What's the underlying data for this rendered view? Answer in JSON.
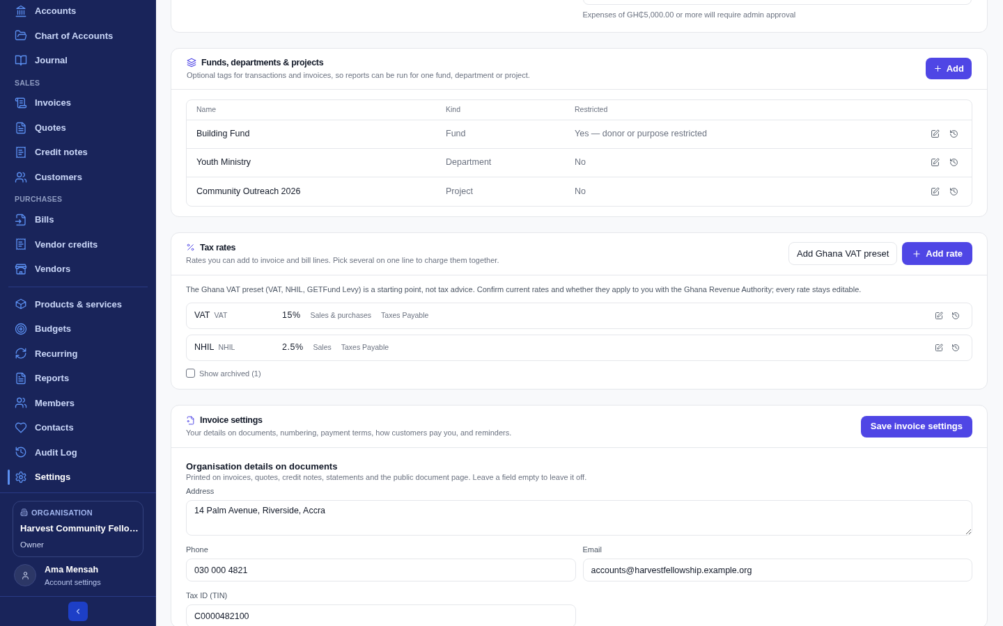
{
  "sidebar": {
    "sections": [
      {
        "items": [
          {
            "label": "Accounts",
            "selected": false
          },
          {
            "label": "Chart of Accounts",
            "selected": false
          },
          {
            "label": "Journal",
            "selected": false
          }
        ]
      },
      {
        "title": "SALES",
        "items": [
          {
            "label": "Invoices",
            "selected": false
          },
          {
            "label": "Quotes",
            "selected": false
          },
          {
            "label": "Credit notes",
            "selected": false
          },
          {
            "label": "Customers",
            "selected": false
          }
        ]
      },
      {
        "title": "PURCHASES",
        "items": [
          {
            "label": "Bills",
            "selected": false
          },
          {
            "label": "Vendor credits",
            "selected": false
          },
          {
            "label": "Vendors",
            "selected": false
          }
        ]
      },
      {
        "items": [
          {
            "label": "Products & services",
            "selected": false
          },
          {
            "label": "Budgets",
            "selected": false
          },
          {
            "label": "Recurring",
            "selected": false
          },
          {
            "label": "Reports",
            "selected": false
          },
          {
            "label": "Members",
            "selected": false
          },
          {
            "label": "Contacts",
            "selected": false
          },
          {
            "label": "Audit Log",
            "selected": false
          },
          {
            "label": "Settings",
            "selected": true
          }
        ]
      }
    ],
    "organisation": {
      "label": "ORGANISATION",
      "name": "Harvest Community Fello…",
      "role": "Owner"
    },
    "user": {
      "name": "Ama Mensah",
      "link": "Account settings"
    }
  },
  "approval_card": {
    "hint": "Expenses of GH₵5,000.00 or more will require admin approval"
  },
  "funds": {
    "title": "Funds, departments & projects",
    "subtitle": "Optional tags for transactions and invoices, so reports can be run for one fund, department or project.",
    "add_button": "Add",
    "columns": [
      "Name",
      "Kind",
      "Restricted"
    ],
    "rows": [
      {
        "name": "Building Fund",
        "kind": "Fund",
        "restricted": "Yes — donor or purpose restricted"
      },
      {
        "name": "Youth Ministry",
        "kind": "Department",
        "restricted": "No"
      },
      {
        "name": "Community Outreach 2026",
        "kind": "Project",
        "restricted": "No"
      }
    ]
  },
  "tax_rates": {
    "title": "Tax rates",
    "subtitle": "Rates you can add to invoice and bill lines. Pick several on one line to charge them together.",
    "preset_button": "Add Ghana VAT preset",
    "add_button": "Add rate",
    "note": "The Ghana VAT preset (VAT, NHIL, GETFund Levy) is a starting point, not tax advice. Confirm current rates and whether they apply to you with the Ghana Revenue Authority; every rate stays editable.",
    "rates": [
      {
        "name": "VAT",
        "code": "VAT",
        "rate": "15%",
        "scope": "Sales & purchases",
        "account": "Taxes Payable"
      },
      {
        "name": "NHIL",
        "code": "NHIL",
        "rate": "2.5%",
        "scope": "Sales",
        "account": "Taxes Payable"
      }
    ],
    "show_archived": {
      "label": "Show archived (1)",
      "checked": false
    }
  },
  "invoice_settings": {
    "title": "Invoice settings",
    "subtitle": "Your details on documents, numbering, payment terms, how customers pay you, and reminders.",
    "save_button": "Save invoice settings",
    "section_title": "Organisation details on documents",
    "section_subtitle": "Printed on invoices, quotes, credit notes, statements and the public document page. Leave a field empty to leave it off.",
    "fields": [
      {
        "kind": "textarea",
        "label": "Address",
        "value": "14 Palm Avenue, Riverside, Accra"
      },
      {
        "kind": "input",
        "label": "Phone",
        "value": "030 000 4821"
      },
      {
        "kind": "input",
        "label": "Email",
        "value": "accounts@harvestfellowship.example.org"
      },
      {
        "kind": "input",
        "label": "Tax ID (TIN)",
        "value": "C0000482100"
      }
    ]
  }
}
